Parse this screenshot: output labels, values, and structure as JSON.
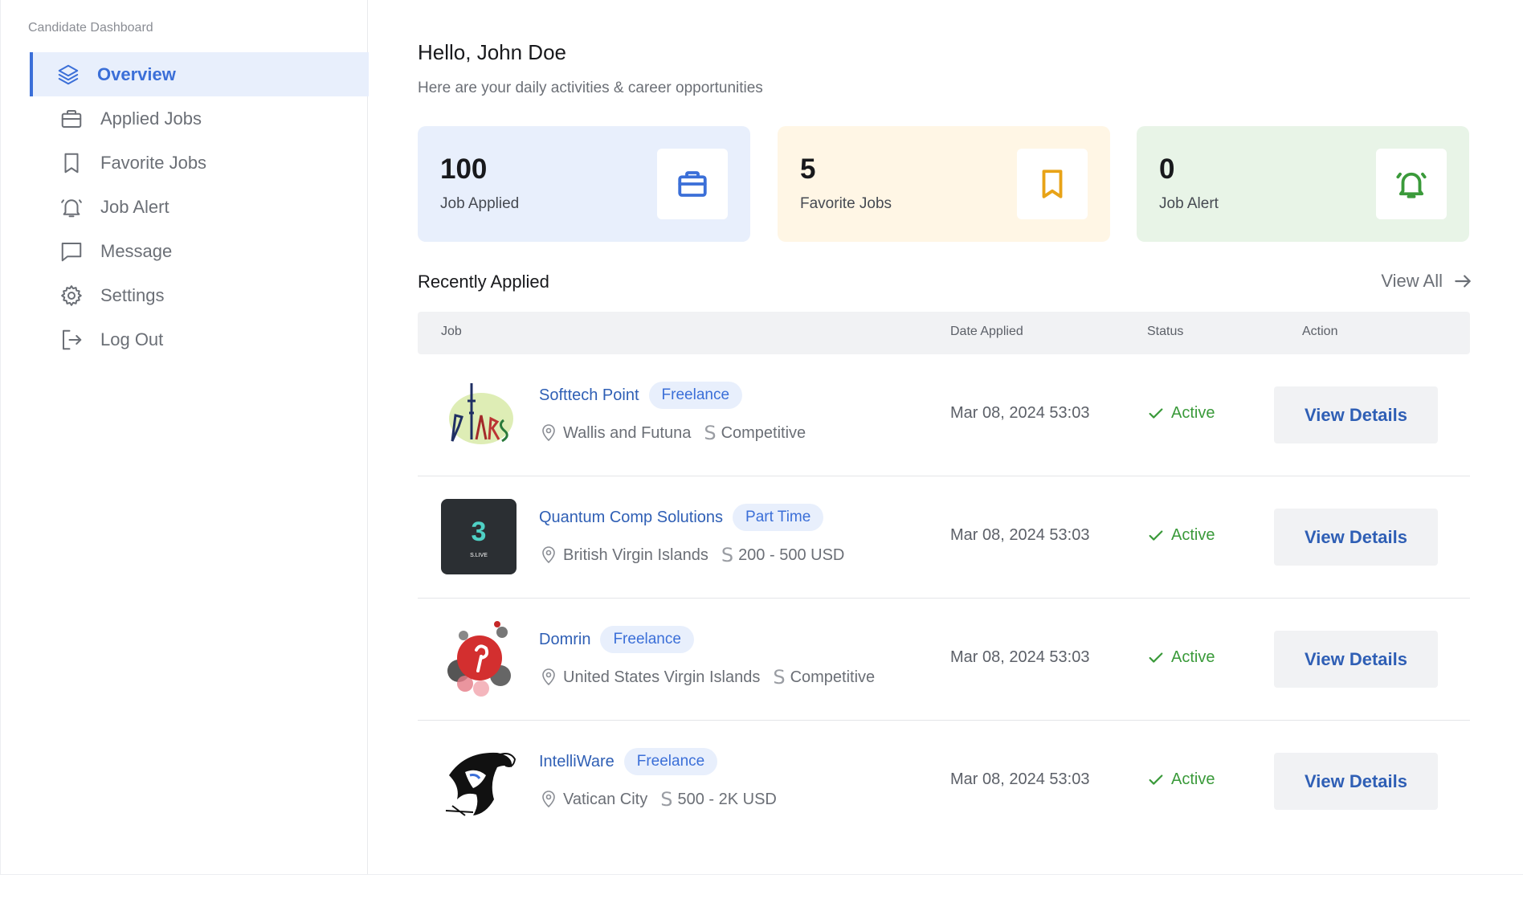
{
  "sidebar": {
    "title": "Candidate Dashboard",
    "items": [
      {
        "label": "Overview",
        "icon": "layers-icon",
        "active": true
      },
      {
        "label": "Applied Jobs",
        "icon": "briefcase-icon"
      },
      {
        "label": "Favorite Jobs",
        "icon": "bookmark-icon"
      },
      {
        "label": "Job Alert",
        "icon": "bell-icon"
      },
      {
        "label": "Message",
        "icon": "message-icon"
      },
      {
        "label": "Settings",
        "icon": "gear-icon"
      },
      {
        "label": "Log Out",
        "icon": "logout-icon"
      }
    ]
  },
  "header": {
    "greeting": "Hello, John Doe",
    "subtitle": "Here are your daily activities & career opportunities"
  },
  "stats": [
    {
      "value": "100",
      "label": "Job Applied",
      "icon": "briefcase-icon",
      "color": "#3b6fd8"
    },
    {
      "value": "5",
      "label": "Favorite Jobs",
      "icon": "bookmark-icon",
      "color": "#e8a317"
    },
    {
      "value": "0",
      "label": "Job Alert",
      "icon": "bell-icon",
      "color": "#3a9a3a"
    }
  ],
  "recent": {
    "title": "Recently Applied",
    "view_all": "View All",
    "columns": {
      "job": "Job",
      "date": "Date Applied",
      "status": "Status",
      "action": "Action"
    },
    "rows": [
      {
        "company": "Softtech Point",
        "type": "Freelance",
        "location": "Wallis and Futuna",
        "salary": "Competitive",
        "date": "Mar 08, 2024 53:03",
        "status": "Active",
        "action": "View Details",
        "logo": "paris-logo"
      },
      {
        "company": "Quantum Comp Solutions",
        "type": "Part Time",
        "location": "British Virgin Islands",
        "salary": "200 - 500 USD",
        "date": "Mar 08, 2024 53:03",
        "status": "Active",
        "action": "View Details",
        "logo": "slive-logo",
        "logo_text": "S.LIVE"
      },
      {
        "company": "Domrin",
        "type": "Freelance",
        "location": "United States Virgin Islands",
        "salary": "Competitive",
        "date": "Mar 08, 2024 53:03",
        "status": "Active",
        "action": "View Details",
        "logo": "pinterest-logo"
      },
      {
        "company": "IntelliWare",
        "type": "Freelance",
        "location": "Vatican City",
        "salary": "500 - 2K USD",
        "date": "Mar 08, 2024 53:03",
        "status": "Active",
        "action": "View Details",
        "logo": "fish-logo"
      }
    ]
  },
  "colors": {
    "accent": "#3b6fd8",
    "active_status": "#3a9a3a",
    "favorite": "#e8a317"
  }
}
